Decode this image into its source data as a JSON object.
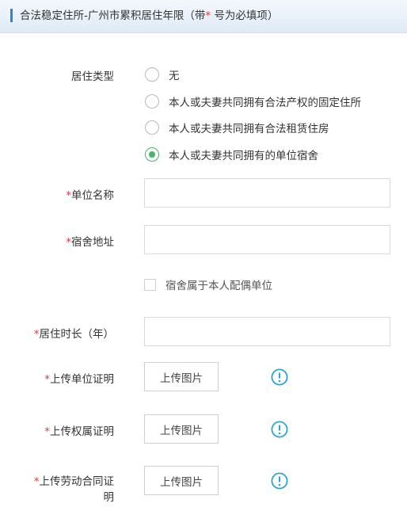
{
  "header": {
    "title_prefix": "合法稳定住所-广州市累积居住年限（带",
    "required_mark": "*",
    "title_suffix": "号为必填项）"
  },
  "residence_type": {
    "label": "居住类型",
    "options": [
      {
        "label": "无",
        "selected": false
      },
      {
        "label": "本人或夫妻共同拥有合法产权的固定住所",
        "selected": false
      },
      {
        "label": "本人或夫妻共同拥有合法租赁住房",
        "selected": false
      },
      {
        "label": "本人或夫妻共同拥有的单位宿舍",
        "selected": true
      }
    ]
  },
  "unit_name": {
    "required_mark": "*",
    "label": "单位名称",
    "value": ""
  },
  "dorm_address": {
    "required_mark": "*",
    "label": "宿舍地址",
    "value": ""
  },
  "dorm_spouse_checkbox": {
    "label": "宿舍属于本人配偶单位",
    "checked": false
  },
  "residence_years": {
    "required_mark": "*",
    "label": "居住时长（年）",
    "value": ""
  },
  "uploads": [
    {
      "required_mark": "*",
      "label": "上传单位证明",
      "button": "上传图片"
    },
    {
      "required_mark": "*",
      "label": "上传权属证明",
      "button": "上传图片"
    },
    {
      "required_mark": "*",
      "label_line1": "上传劳动合同证",
      "label_line2": "明",
      "button": "上传图片"
    }
  ],
  "colors": {
    "accent_bar": "#2e86d2",
    "required": "#e03a3a",
    "radio_selected": "#4cb36b",
    "info_icon": "#2ba3d6"
  },
  "icons": {
    "info": "exclamation-circle-icon"
  }
}
